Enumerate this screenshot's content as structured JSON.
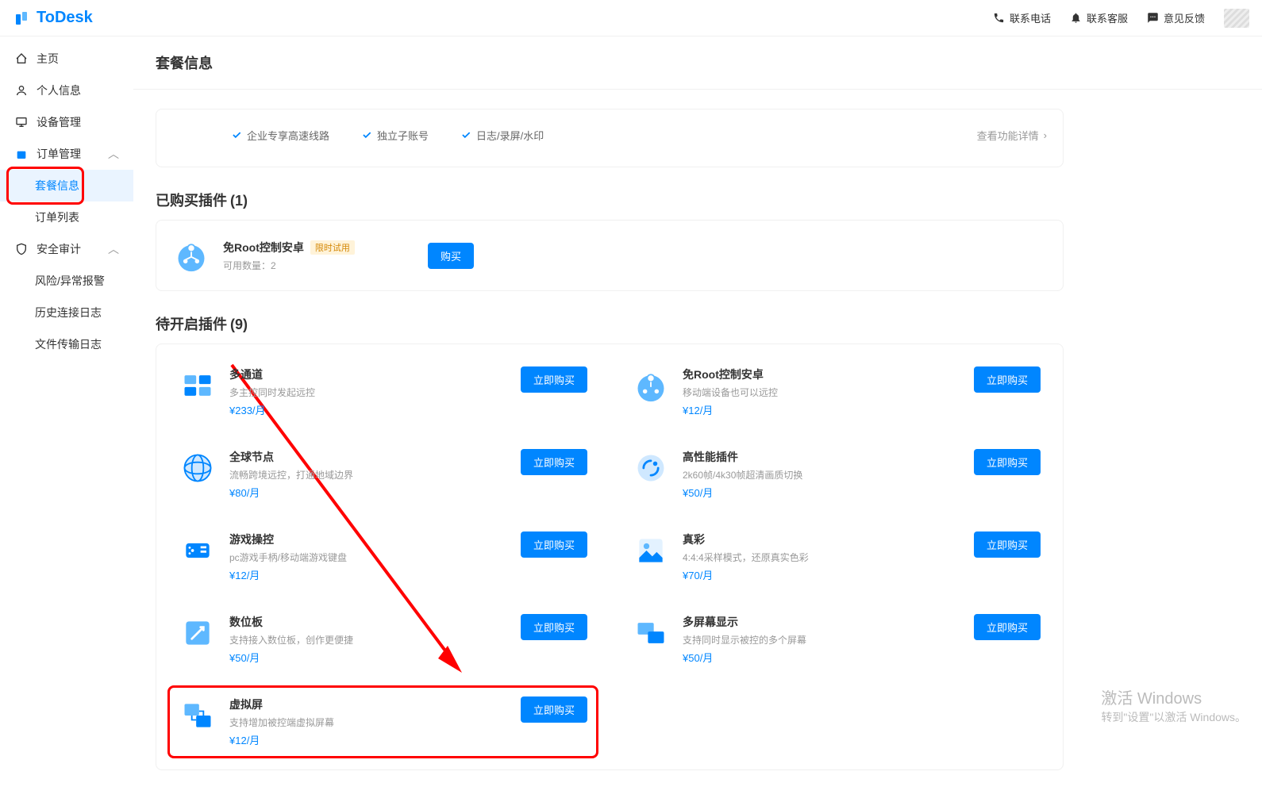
{
  "logo": "ToDesk",
  "header": {
    "phone": "联系电话",
    "service": "联系客服",
    "feedback": "意见反馈"
  },
  "sidebar": {
    "home": "主页",
    "profile": "个人信息",
    "devices": "设备管理",
    "orders": "订单管理",
    "package_info": "套餐信息",
    "order_list": "订单列表",
    "security": "安全审计",
    "risk": "风险/异常报警",
    "connect_log": "历史连接日志",
    "transfer_log": "文件传输日志"
  },
  "page_title": "套餐信息",
  "enterprise": {
    "feat1": "企业专享高速线路",
    "feat2": "独立子账号",
    "feat3": "日志/录屏/水印",
    "detail": "查看功能详情"
  },
  "purchased": {
    "title": "已购买插件",
    "count": "(1)"
  },
  "plugin_purchased": {
    "name": "免Root控制安卓",
    "badge": "限时试用",
    "desc": "可用数量：2",
    "btn": "购买"
  },
  "pending": {
    "title": "待开启插件",
    "count": "(9)"
  },
  "buy_now": "立即购买",
  "plugins": [
    {
      "name": "多通道",
      "desc": "多主控同时发起远控",
      "price": "¥233/月"
    },
    {
      "name": "免Root控制安卓",
      "desc": "移动端设备也可以远控",
      "price": "¥12/月"
    },
    {
      "name": "全球节点",
      "desc": "流畅跨境远控，打通地域边界",
      "price": "¥80/月"
    },
    {
      "name": "高性能插件",
      "desc": "2k60帧/4k30帧超清画质切换",
      "price": "¥50/月"
    },
    {
      "name": "游戏操控",
      "desc": "pc游戏手柄/移动端游戏键盘",
      "price": "¥12/月"
    },
    {
      "name": "真彩",
      "desc": "4:4:4采样模式，还原真实色彩",
      "price": "¥70/月"
    },
    {
      "name": "数位板",
      "desc": "支持接入数位板，创作更便捷",
      "price": "¥50/月"
    },
    {
      "name": "多屏幕显示",
      "desc": "支持同时显示被控的多个屏幕",
      "price": "¥50/月"
    },
    {
      "name": "虚拟屏",
      "desc": "支持增加被控端虚拟屏幕",
      "price": "¥12/月"
    }
  ],
  "watermark": {
    "t": "激活 Windows",
    "s": "转到\"设置\"以激活 Windows。"
  }
}
